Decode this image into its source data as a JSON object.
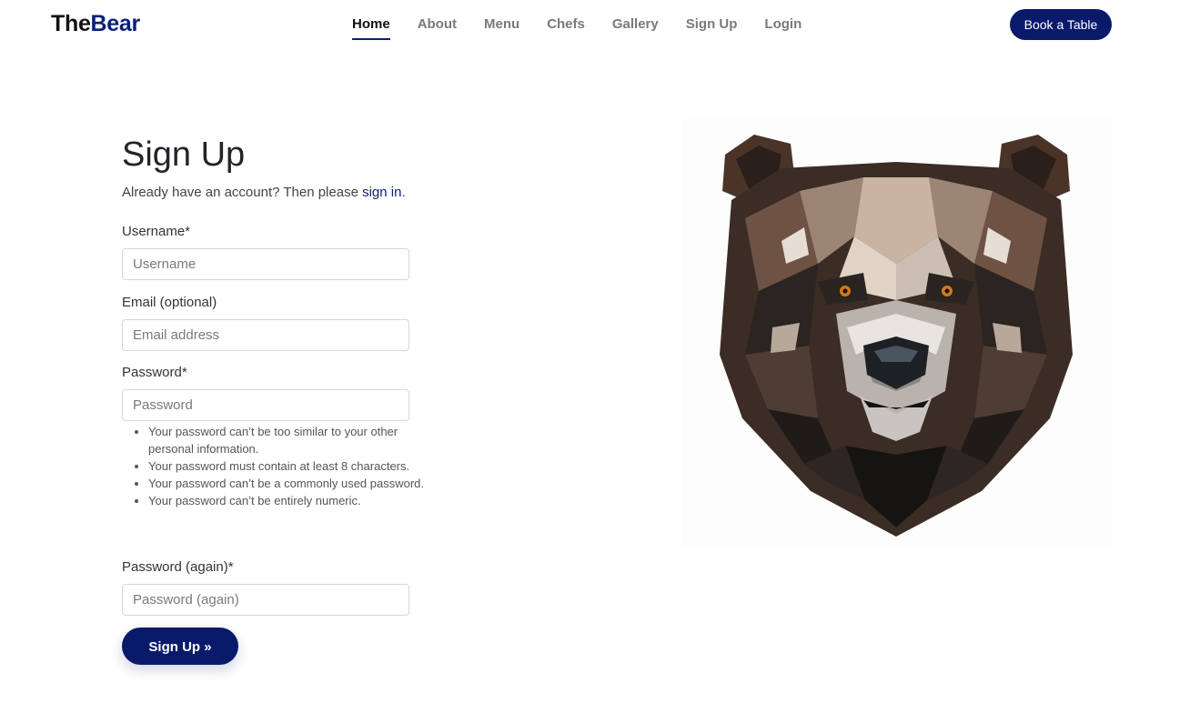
{
  "brand": {
    "part1": "The",
    "part2": "Bear",
    "primary_color": "#0a1a6b"
  },
  "nav": {
    "items": [
      {
        "label": "Home",
        "active": true
      },
      {
        "label": "About"
      },
      {
        "label": "Menu"
      },
      {
        "label": "Chefs"
      },
      {
        "label": "Gallery"
      },
      {
        "label": "Sign Up"
      },
      {
        "label": "Login"
      }
    ],
    "book_label": "Book a Table"
  },
  "form": {
    "title": "Sign Up",
    "subtitle_text": "Already have an account? Then please ",
    "subtitle_link": "sign in",
    "subtitle_end": ".",
    "username_label": "Username*",
    "username_placeholder": "Username",
    "email_label": "Email (optional)",
    "email_placeholder": "Email address",
    "password_label": "Password*",
    "password_placeholder": "Password",
    "password_help": [
      "Your password can’t be too similar to your other personal information.",
      "Your password must contain at least 8 characters.",
      "Your password can’t be a commonly used password.",
      "Your password can’t be entirely numeric."
    ],
    "password2_label": "Password (again)*",
    "password2_placeholder": "Password (again)",
    "submit_label": "Sign Up »"
  },
  "image": {
    "icon": "geometric-bear-head-icon"
  }
}
